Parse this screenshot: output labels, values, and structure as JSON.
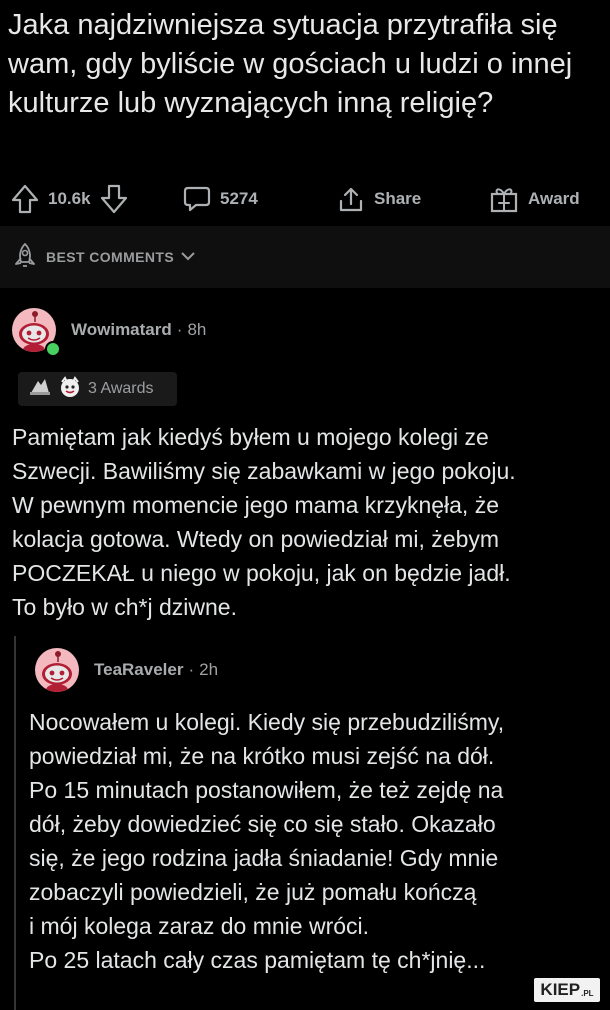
{
  "post": {
    "title": "Jaka najdziwniejsza sytuacja przytrafiła się wam, gdy byliście w gościach u ludzi o innej kulturze lub wyznających inną religię?"
  },
  "actions": {
    "upvotes": "10.6k",
    "comments": "5274",
    "share_label": "Share",
    "award_label": "Award"
  },
  "sort": {
    "label": "BEST COMMENTS"
  },
  "comments": [
    {
      "username": "Wowimatard",
      "separator": "·",
      "time": "8h",
      "awards": "3 Awards",
      "text": "Pamiętam jak kiedyś byłem u mojego kolegi ze\nSzwecji. Bawiliśmy się zabawkami w jego pokoju.\nW pewnym momencie jego mama krzyknęła, że\nkolacja gotowa. Wtedy on powiedział mi, żebym\nPOCZEKAŁ u niego w pokoju, jak on będzie jadł.\nTo było w ch*j dziwne."
    },
    {
      "username": "TeaRaveler",
      "separator": "·",
      "time": "2h",
      "text": "Nocowałem u kolegi. Kiedy się przebudziliśmy,\npowiedział mi, że na krótko musi zejść na dół.\nPo 15 minutach postanowiłem, że też zejdę na\ndół, żeby dowiedzieć się co się stało. Okazało\nsię, że jego rodzina jadła śniadanie! Gdy mnie\nzobaczyli powiedzieli, że już pomału kończą\ni mój kolega zaraz do mnie wróci.\nPo 25 latach cały czas pamiętam tę ch*jnię..."
    }
  ],
  "watermark": {
    "main": "KIEP",
    "suffix": ".PL"
  },
  "colors": {
    "background": "#000000",
    "avatar": "#f3b9bf",
    "online": "#46d160",
    "muted": "#9fa2a4"
  }
}
